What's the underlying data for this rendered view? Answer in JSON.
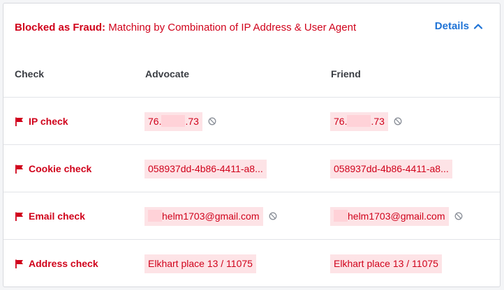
{
  "alert": {
    "title": "Blocked as Fraud:",
    "message": " Matching by Combination of IP Address & User Agent",
    "details_label": "Details",
    "details_icon": "chevron-up-icon"
  },
  "columns": {
    "check": "Check",
    "advocate": "Advocate",
    "friend": "Friend"
  },
  "rows": [
    {
      "label": "IP check",
      "advocate_prefix": "76.",
      "advocate_suffix": ".73",
      "friend_prefix": "76.",
      "friend_suffix": ".73",
      "has_block_icon": true
    },
    {
      "label": "Cookie check",
      "advocate": "058937dd-4b86-4411-a8...",
      "friend": "058937dd-4b86-4411-a8...",
      "has_block_icon": false
    },
    {
      "label": "Email check",
      "advocate_suffix": "helm1703@gmail.com",
      "friend_suffix": "helm1703@gmail.com",
      "has_block_icon": true
    },
    {
      "label": "Address check",
      "advocate": "Elkhart place 13 / 11075",
      "friend": "Elkhart place 13 / 11075",
      "has_block_icon": false
    }
  ],
  "colors": {
    "alert_red": "#d0021b",
    "link_blue": "#1f73d6",
    "pill_bg": "#fde3e6"
  },
  "icons": {
    "flag": "flag-icon",
    "block": "block-icon"
  }
}
